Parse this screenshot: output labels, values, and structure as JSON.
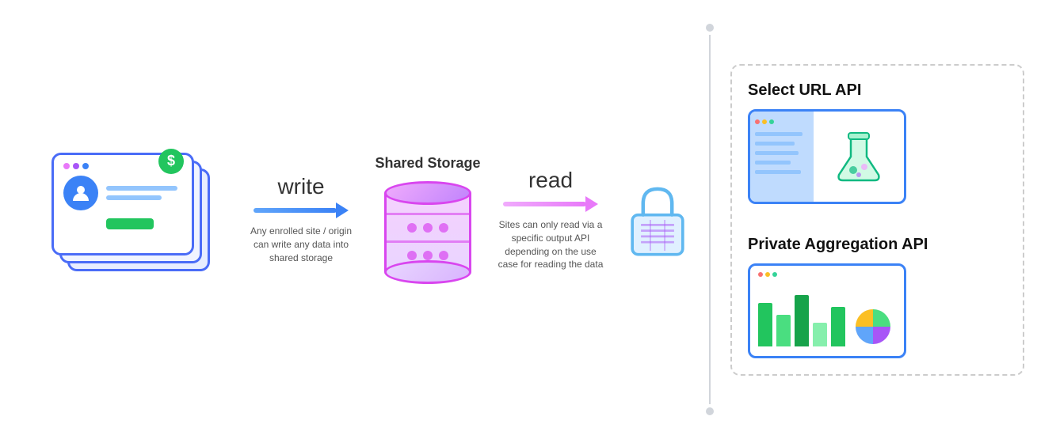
{
  "diagram": {
    "write_label": "write",
    "read_label": "read",
    "shared_storage_title": "Shared Storage",
    "write_description": "Any enrolled site / origin can write any data into shared storage",
    "read_description": "Sites can only read via a specific output API depending on the use case for reading the data",
    "select_url_api_title": "Select URL API",
    "private_aggregation_api_title": "Private Aggregation API"
  },
  "icons": {
    "dollar_sign": "$",
    "avatar": "👤"
  }
}
